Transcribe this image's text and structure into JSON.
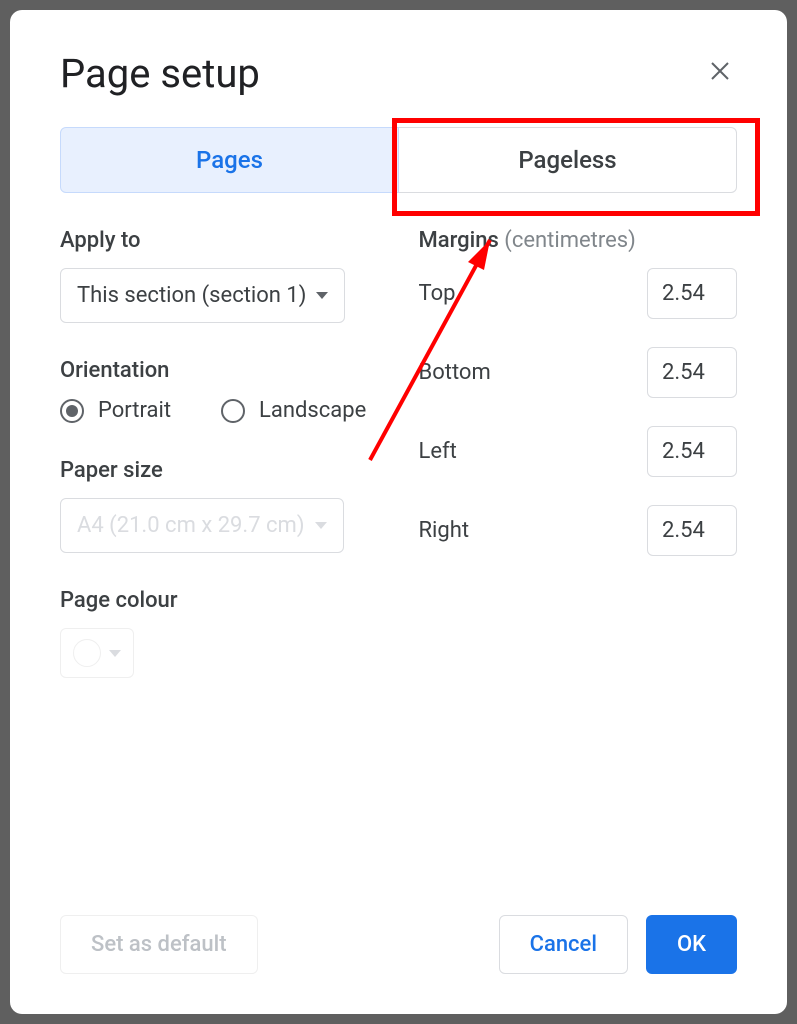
{
  "dialog": {
    "title": "Page setup",
    "tabs": {
      "pages": "Pages",
      "pageless": "Pageless"
    },
    "applyTo": {
      "label": "Apply to",
      "value": "This section (section 1)"
    },
    "orientation": {
      "label": "Orientation",
      "portrait": "Portrait",
      "landscape": "Landscape",
      "selected": "portrait"
    },
    "paperSize": {
      "label": "Paper size",
      "value": "A4 (21.0 cm x 29.7 cm)"
    },
    "pageColour": {
      "label": "Page colour"
    },
    "margins": {
      "label": "Margins",
      "unit": "(centimetres)",
      "top": {
        "label": "Top",
        "value": "2.54"
      },
      "bottom": {
        "label": "Bottom",
        "value": "2.54"
      },
      "left": {
        "label": "Left",
        "value": "2.54"
      },
      "right": {
        "label": "Right",
        "value": "2.54"
      }
    },
    "buttons": {
      "setDefault": "Set as default",
      "cancel": "Cancel",
      "ok": "OK"
    }
  }
}
